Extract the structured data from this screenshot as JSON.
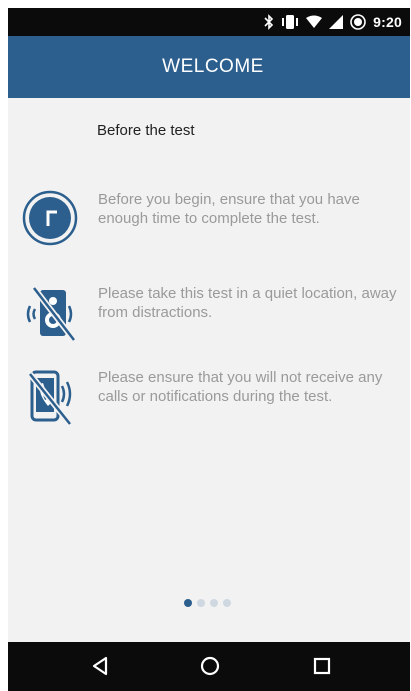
{
  "status_bar": {
    "time": "9:20",
    "icons": [
      "bluetooth-icon",
      "vibrate-icon",
      "wifi-icon",
      "signal-icon",
      "battery-saver-icon"
    ]
  },
  "app_bar": {
    "title": "WELCOME"
  },
  "content": {
    "section_title": "Before the test",
    "tips": [
      {
        "icon": "clock-icon",
        "text": "Before you begin, ensure that you have enough time to complete the test."
      },
      {
        "icon": "speaker-muted-icon",
        "text": "Please take this test in a quiet location, away from distractions."
      },
      {
        "icon": "phone-no-calls-icon",
        "text": "Please ensure that you will not receive any calls or notifications during the test."
      }
    ]
  },
  "pagination": {
    "current": 1,
    "total": 4
  },
  "nav_bar": {
    "buttons": [
      "back-icon",
      "home-icon",
      "recents-icon"
    ]
  },
  "colors": {
    "primary": "#2c5f8d",
    "background": "#f2f2f2",
    "tip_text": "#9a9a9a",
    "status_bar": "#0b0b0b"
  }
}
